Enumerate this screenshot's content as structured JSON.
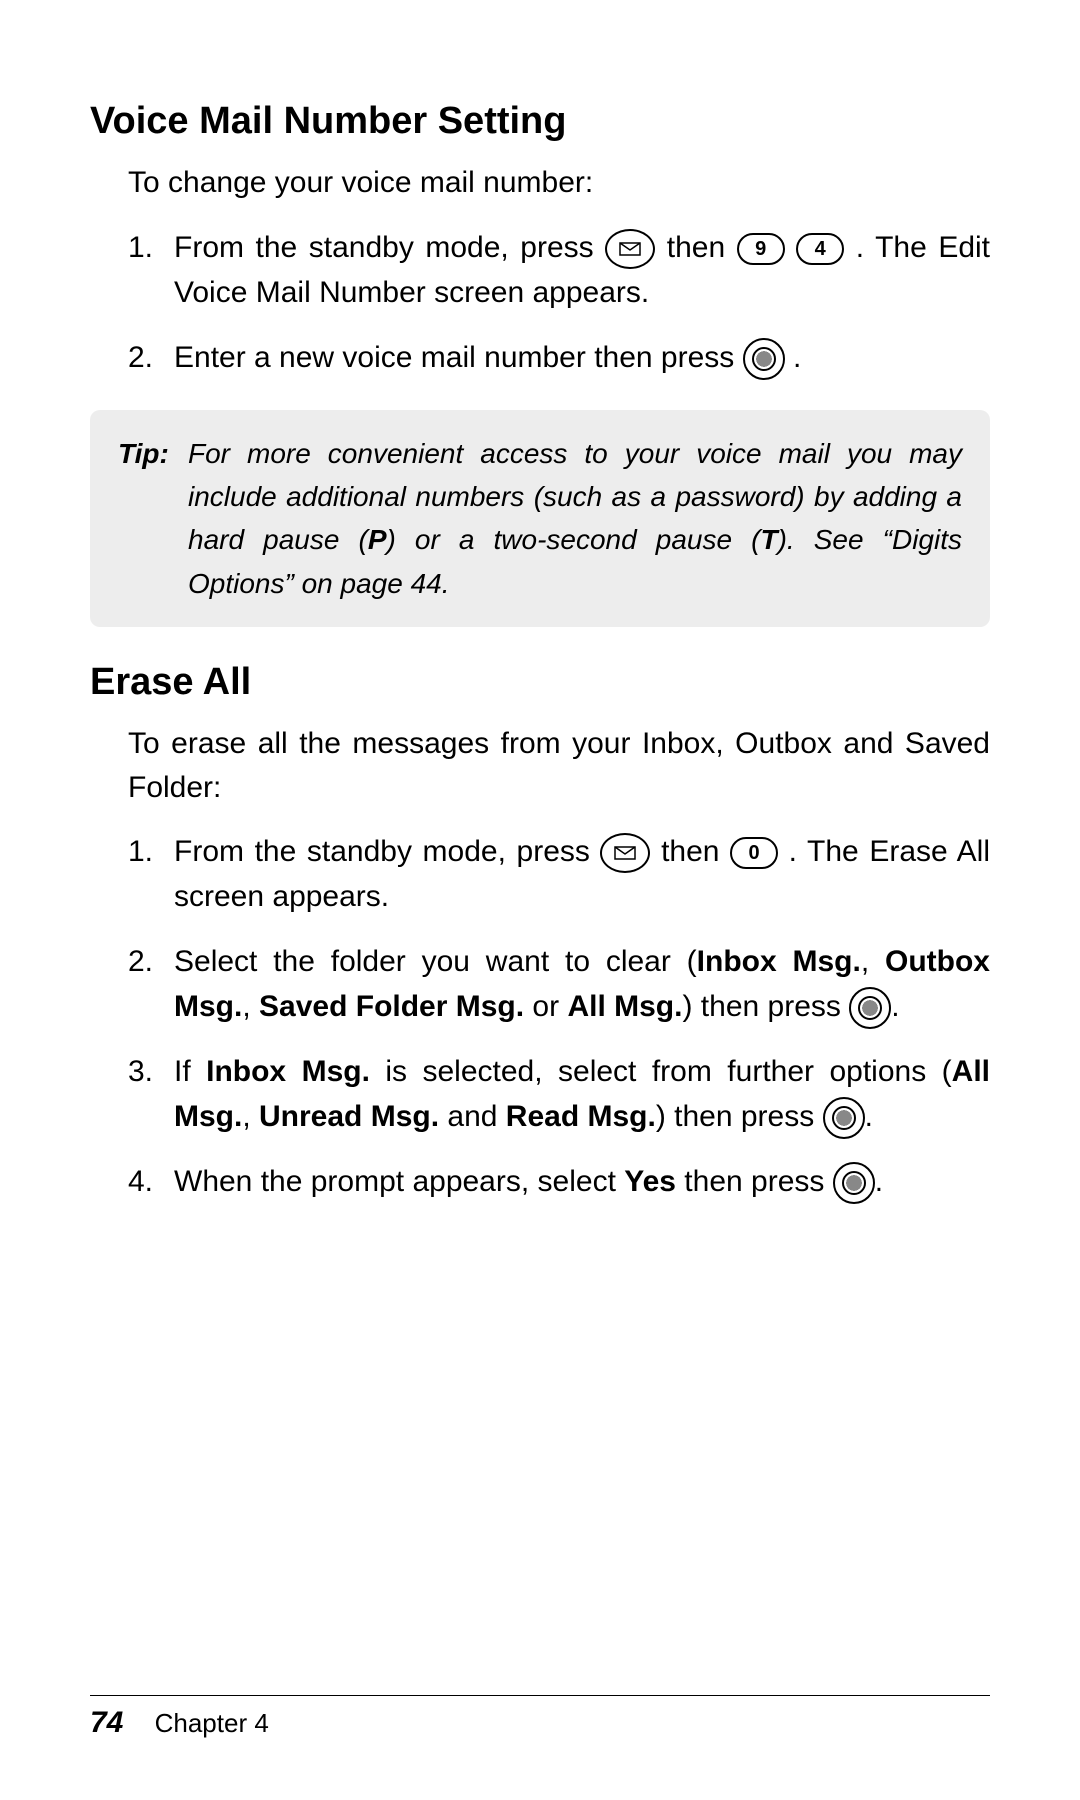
{
  "section1": {
    "heading": "Voice Mail Number Setting",
    "intro": "To change your voice mail number:",
    "steps": {
      "s1a": "From the standby mode, press ",
      "s1b": " then ",
      "s1c": ". The Edit Voice Mail Number screen appears.",
      "key9": "9",
      "key4": "4",
      "s2a": "Enter a new voice mail number then press ",
      "s2b": "."
    }
  },
  "tip": {
    "label": "Tip:",
    "t1": "For more convenient access to your voice mail you may include additional numbers (such as a password) by adding a hard pause (",
    "p": "P",
    "t2": ") or a two-second pause (",
    "tkey": "T",
    "t3": "). See “Digits Options” on page 44."
  },
  "section2": {
    "heading": "Erase All",
    "intro": "To erase all the messages from your Inbox, Outbox and Saved Folder:",
    "steps": {
      "s1a": "From the standby mode, press ",
      "s1b": " then ",
      "key0": "0",
      "s1c": ". The Erase All screen appears.",
      "s2a": "Select the folder you want to clear (",
      "s2b_inbox": "Inbox Msg.",
      "s2c": ", ",
      "s2d_outbox": "Outbox Msg.",
      "s2e": ", ",
      "s2f_saved": "Saved Folder Msg.",
      "s2g": " or ",
      "s2h_all": "All Msg.",
      "s2i": ") then press ",
      "s2j": ".",
      "s3a": "If ",
      "s3b_inbox": "Inbox Msg.",
      "s3c": " is selected, select from further options (",
      "s3d_all": "All Msg.",
      "s3e": ", ",
      "s3f_unread": "Unread Msg.",
      "s3g": " and ",
      "s3h_read": "Read Msg.",
      "s3i": ") then press ",
      "s3j": ".",
      "s4a": "When the prompt appears, select ",
      "s4b_yes": "Yes",
      "s4c": " then press ",
      "s4d": "."
    }
  },
  "footer": {
    "page": "74",
    "chapter": "Chapter 4"
  }
}
